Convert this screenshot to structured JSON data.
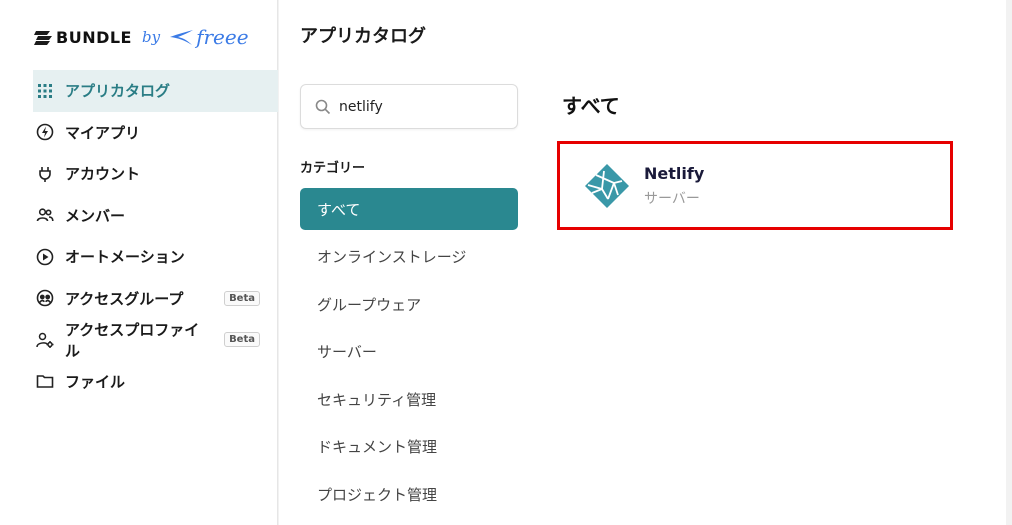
{
  "logo": {
    "bundle": "BUNDLE",
    "by": "by",
    "freee": "freee"
  },
  "sidebar": {
    "items": [
      {
        "label": "アプリカタログ",
        "icon": "grid-icon",
        "active": true
      },
      {
        "label": "マイアプリ",
        "icon": "bolt-circle-icon"
      },
      {
        "label": "アカウント",
        "icon": "plug-icon"
      },
      {
        "label": "メンバー",
        "icon": "users-icon"
      },
      {
        "label": "オートメーション",
        "icon": "play-circle-icon"
      },
      {
        "label": "アクセスグループ",
        "icon": "group-face-icon",
        "badge": "Beta"
      },
      {
        "label": "アクセスプロファイル",
        "icon": "user-gear-icon",
        "badge": "Beta"
      },
      {
        "label": "ファイル",
        "icon": "folder-icon"
      }
    ]
  },
  "main": {
    "title": "アプリカタログ",
    "search": {
      "value": "netlify",
      "placeholder": ""
    },
    "category_title": "カテゴリー",
    "categories": [
      {
        "label": "すべて",
        "active": true
      },
      {
        "label": "オンラインストレージ"
      },
      {
        "label": "グループウェア"
      },
      {
        "label": "サーバー"
      },
      {
        "label": "セキュリティ管理"
      },
      {
        "label": "ドキュメント管理"
      },
      {
        "label": "プロジェクト管理"
      }
    ],
    "section_title": "すべて",
    "apps": [
      {
        "name": "Netlify",
        "category": "サーバー"
      }
    ]
  },
  "colors": {
    "accent": "#2a8890",
    "active_bg": "#e6f0f1",
    "highlight": "#e60000",
    "brand": "#3b7be6"
  }
}
